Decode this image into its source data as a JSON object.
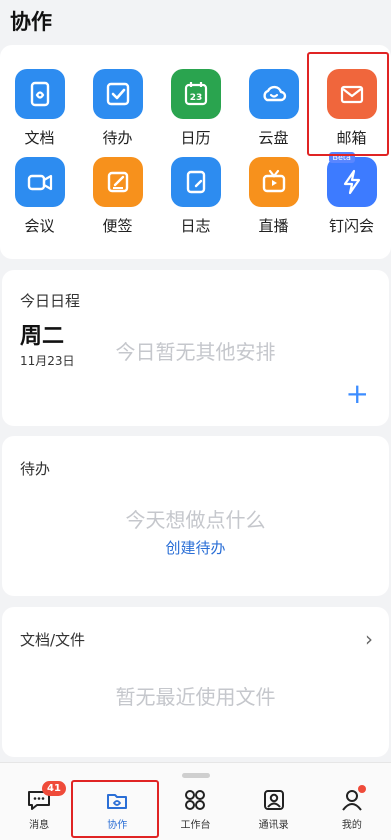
{
  "header": {
    "title": "协作"
  },
  "apps": [
    {
      "label": "文档",
      "icon": "document-icon",
      "color": "#2d8cf0"
    },
    {
      "label": "待办",
      "icon": "todo-check-icon",
      "color": "#2d8cf0"
    },
    {
      "label": "日历",
      "icon": "calendar-icon",
      "color": "#2aa44f",
      "day": "23"
    },
    {
      "label": "云盘",
      "icon": "cloud-drive-icon",
      "color": "#2d8cf0"
    },
    {
      "label": "邮箱",
      "icon": "mail-icon",
      "color": "#f0663c"
    },
    {
      "label": "会议",
      "icon": "video-meeting-icon",
      "color": "#2d8cf0"
    },
    {
      "label": "便签",
      "icon": "note-edit-icon",
      "color": "#f7911c"
    },
    {
      "label": "日志",
      "icon": "log-icon",
      "color": "#2d8cf0"
    },
    {
      "label": "直播",
      "icon": "live-tv-icon",
      "color": "#f7911c"
    },
    {
      "label": "钉闪会",
      "icon": "flash-meeting-icon",
      "color": "#3d7bff",
      "badge": "Beta"
    }
  ],
  "schedule": {
    "label": "今日日程",
    "day": "周二",
    "date": "11月23日",
    "empty": "今日暂无其他安排",
    "add": "+"
  },
  "todo": {
    "label": "待办",
    "empty": "今天想做点什么",
    "create": "创建待办"
  },
  "docs": {
    "label": "文档/文件",
    "empty": "暂无最近使用文件"
  },
  "tabs": [
    {
      "label": "消息",
      "badge": "41"
    },
    {
      "label": "协作"
    },
    {
      "label": "工作台"
    },
    {
      "label": "通讯录"
    },
    {
      "label": "我的"
    }
  ],
  "colors": {
    "accent": "#2b6fd6",
    "highlight": "#e02424",
    "badge": "#ef4b3a"
  }
}
